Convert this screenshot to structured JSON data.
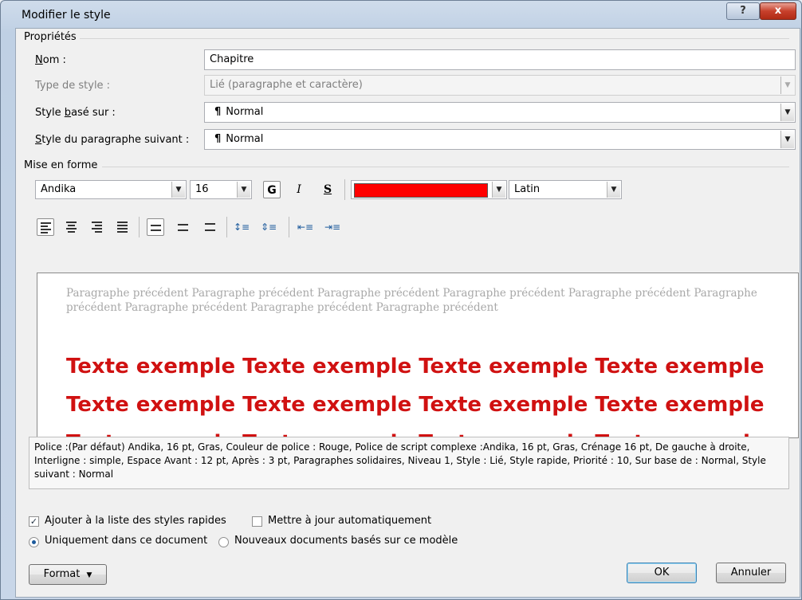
{
  "window": {
    "title": "Modifier le style",
    "help_label": "?",
    "close_label": "x"
  },
  "properties": {
    "section_label": "Propriétés",
    "name": {
      "label": "Nom :",
      "value": "Chapitre"
    },
    "style_type": {
      "label": "Type de style :",
      "value": "Lié (paragraphe et caractère)"
    },
    "based_on": {
      "label": "Style basé sur :",
      "value": "Normal"
    },
    "next_style": {
      "label": "Style du paragraphe suivant :",
      "value": "Normal"
    }
  },
  "formatting": {
    "section_label": "Mise en forme",
    "font": "Andika",
    "size": "16",
    "bold_label": "G",
    "italic_label": "I",
    "underline_label": "S",
    "font_color": "#ff0000",
    "script": "Latin"
  },
  "preview": {
    "previous_paragraph": "Paragraphe précédent Paragraphe précédent Paragraphe précédent Paragraphe précédent Paragraphe précédent Paragraphe précédent Paragraphe précédent Paragraphe précédent Paragraphe précédent",
    "sample_text": "Texte exemple Texte exemple Texte exemple Texte exemple Texte exemple Texte exemple Texte exemple Texte exemple Texte exemple Texte exemple Texte exemple Texte exemple",
    "sample_color": "#d01111"
  },
  "description": "Police :(Par défaut) Andika, 16 pt, Gras, Couleur de police : Rouge, Police de script complexe :Andika, 16 pt, Gras, Crénage 16 pt, De gauche à droite, Interligne : simple, Espace Avant : 12 pt, Après : 3 pt, Paragraphes solidaires, Niveau 1, Style : Lié, Style rapide, Priorité : 10, Sur base de : Normal, Style suivant : Normal",
  "options": {
    "add_quick_styles": {
      "label": "Ajouter à la liste des styles rapides",
      "checked": true
    },
    "auto_update": {
      "label": "Mettre à jour automatiquement",
      "checked": false
    },
    "only_this_document": {
      "label": "Uniquement dans ce document",
      "selected": true
    },
    "new_documents": {
      "label": "Nouveaux documents basés sur ce modèle",
      "selected": false
    }
  },
  "buttons": {
    "format": "Format",
    "ok": "OK",
    "cancel": "Annuler"
  }
}
